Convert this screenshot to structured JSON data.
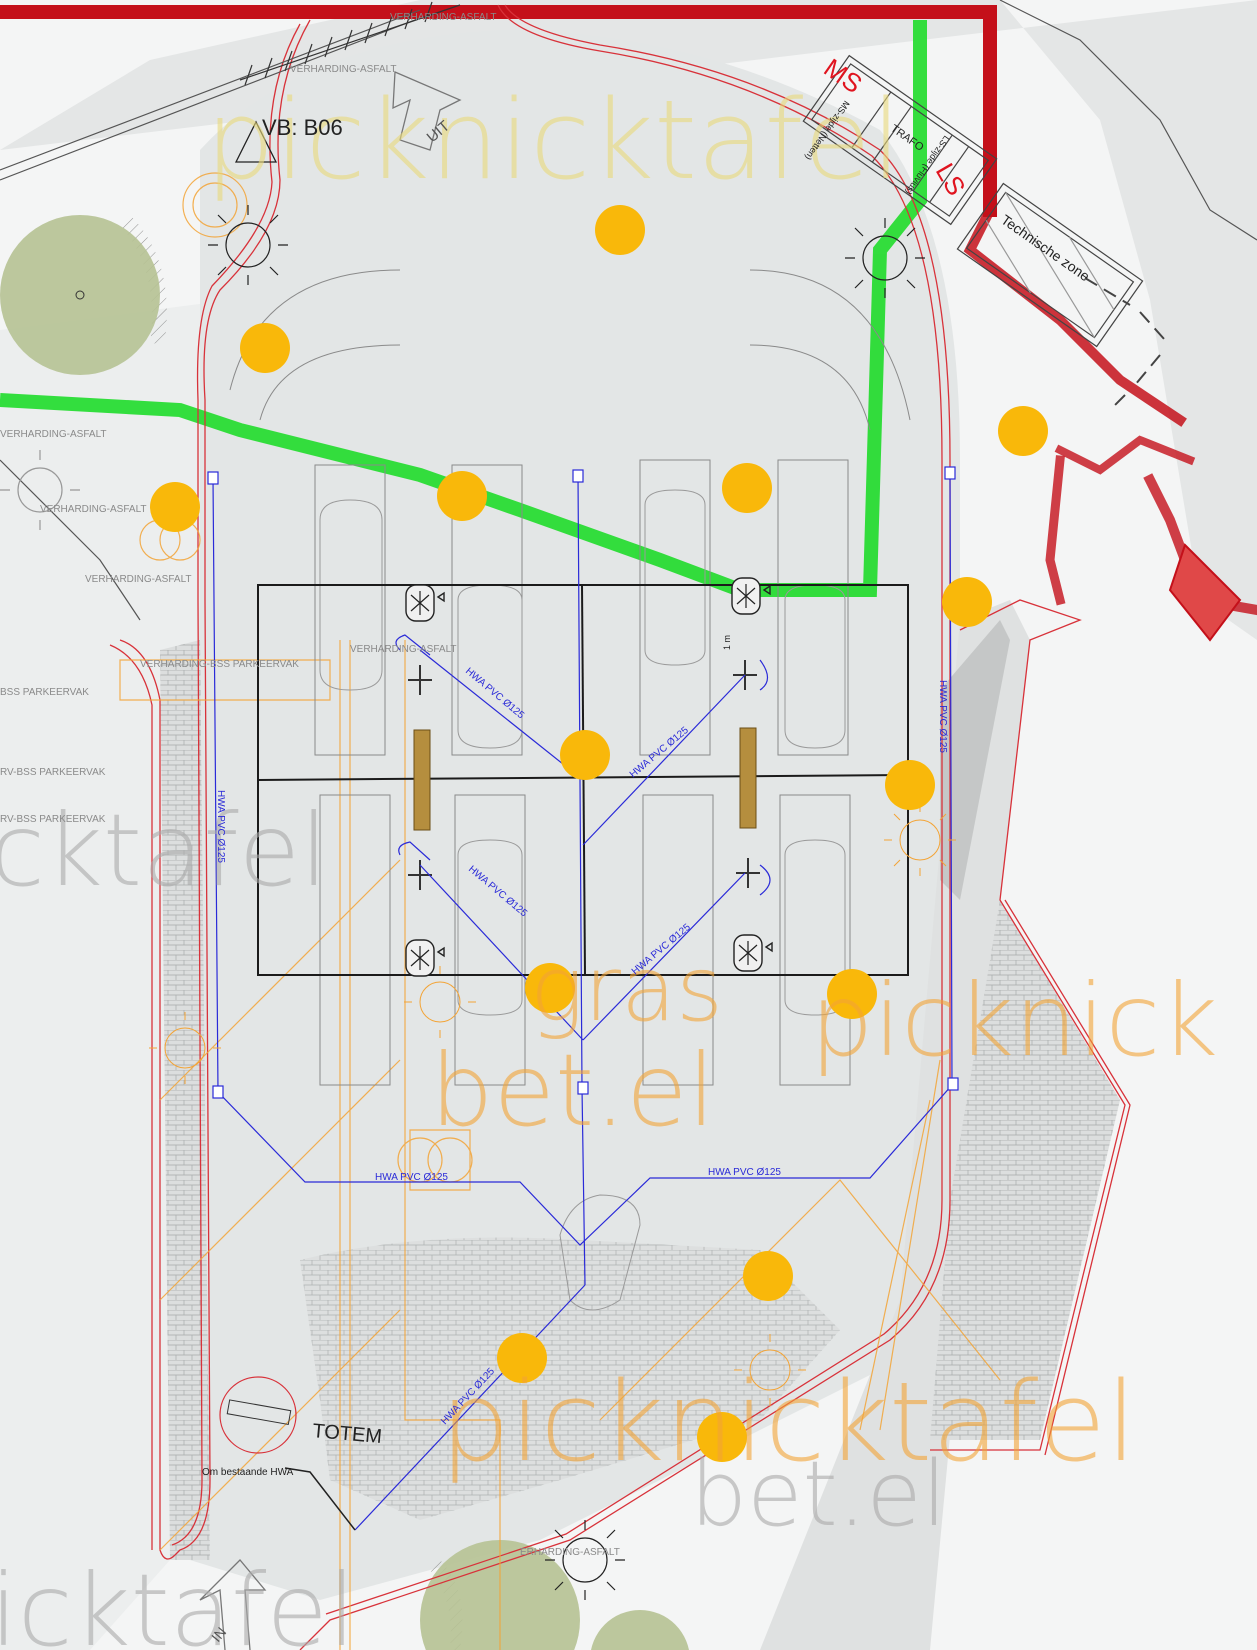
{
  "colors": {
    "background": "#f4f5f5",
    "asphalt": "#e3e6e6",
    "boundary": "#d8323a",
    "drainage": "#2a2ad8",
    "green_cable": "#1fdc2a",
    "red_cable": "#c4101a",
    "light_marker": "#f9b80a",
    "orange_outline": "#f3a436",
    "tree": "#b6c294",
    "pavers": "#c9cccc"
  },
  "labels": {
    "vb": "VB: B06",
    "uit": "UIT",
    "in": "IN",
    "totem": "TOTEM",
    "bestaande_hwa": "Om bestaande HWA",
    "technische_zone": "Technische zone",
    "ms": "MS",
    "ls": "LS",
    "trafo": "TRAFO",
    "ms_zijde": "MS-zijde (Netten)",
    "ls_zijde": "LS-zijde (Fluvius)",
    "one_m": "1 m"
  },
  "pipes": {
    "hwa": "HWA PVC Ø125"
  },
  "surfaces": {
    "asfalt": "VERHARDING-ASFALT",
    "asfalt_short": "ERHARDING-ASFALT",
    "bss": "VERHARDING-BSS PARKEERVAK",
    "bss_short": "RV-BSS PARKEERVAK",
    "parkeervak": "BSS PARKEERVAK"
  },
  "ghost_text": {
    "picknicktafel": "picknicktafel",
    "picknick": "picknick",
    "gras": "gras",
    "bet_el": "bet.el",
    "icktafel": "icktafel",
    "cktafel": "cktafel"
  }
}
